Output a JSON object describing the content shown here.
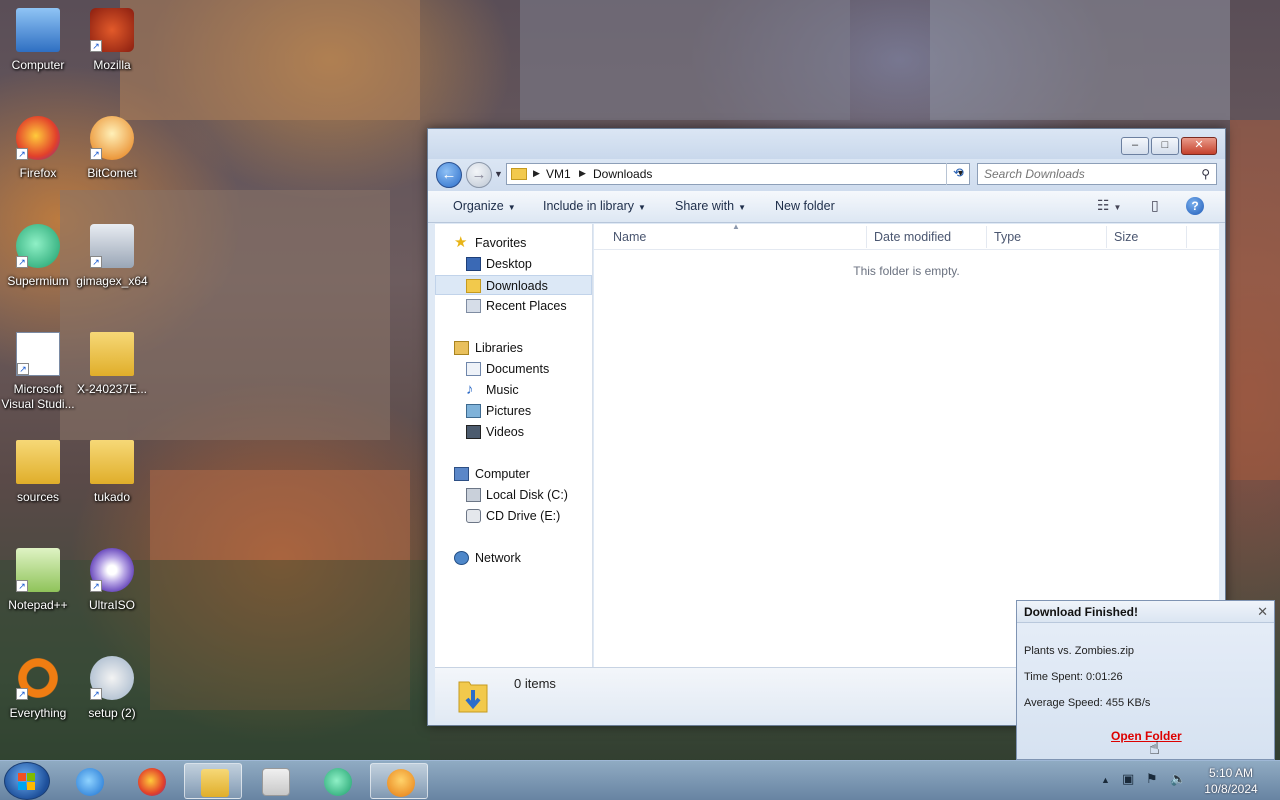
{
  "desktop": {
    "icons": [
      {
        "label": "Computer"
      },
      {
        "label": "Mozilla"
      },
      {
        "label": "Firefox"
      },
      {
        "label": "BitComet"
      },
      {
        "label": "Supermium"
      },
      {
        "label": "gimagex_x64"
      },
      {
        "label": "Microsoft Visual Studi..."
      },
      {
        "label": "X-240237E..."
      },
      {
        "label": "sources"
      },
      {
        "label": "tukado"
      },
      {
        "label": "Notepad++"
      },
      {
        "label": "UltraISO"
      },
      {
        "label": "Everything"
      },
      {
        "label": "setup (2)"
      }
    ]
  },
  "explorer": {
    "titlebar": {
      "minimize": "‒",
      "maximize": "□",
      "close": "✕"
    },
    "breadcrumb": [
      "VM1",
      "Downloads"
    ],
    "search_placeholder": "Search Downloads",
    "commands": [
      "Organize",
      "Include in library",
      "Share with",
      "New folder"
    ],
    "nav": {
      "favorites": {
        "label": "Favorites",
        "items": [
          "Desktop",
          "Downloads",
          "Recent Places"
        ]
      },
      "libraries": {
        "label": "Libraries",
        "items": [
          "Documents",
          "Music",
          "Pictures",
          "Videos"
        ]
      },
      "computer": {
        "label": "Computer",
        "items": [
          "Local Disk (C:)",
          "CD Drive (E:)"
        ]
      },
      "network": {
        "label": "Network"
      }
    },
    "selected_nav": "Downloads",
    "columns": [
      "Name",
      "Date modified",
      "Type",
      "Size"
    ],
    "empty_message": "This folder is empty.",
    "item_count": "0 items"
  },
  "download_notification": {
    "title": "Download Finished!",
    "file": "Plants vs. Zombies.zip",
    "time_spent": "Time Spent: 0:01:26",
    "average_speed": "Average Speed: 455 KB/s",
    "open_folder": "Open Folder"
  },
  "taskbar": {
    "pinned": [
      "internet-explorer",
      "firefox",
      "explorer",
      "media-player",
      "supermium",
      "bitcomet"
    ],
    "active": "explorer",
    "clock_time": "5:10 AM",
    "clock_date": "10/8/2024"
  },
  "colors": {
    "accent": "#2b6dc9",
    "open_folder_link": "#dd0000"
  }
}
